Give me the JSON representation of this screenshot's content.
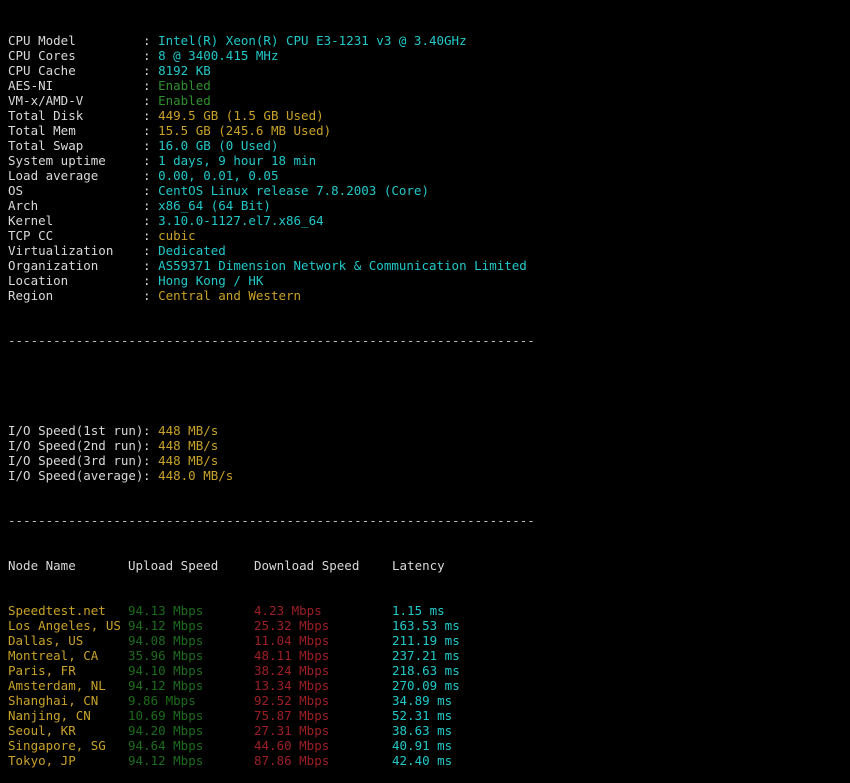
{
  "terminal": {
    "prompt_symbol": "",
    "separator": "----------------------------------------------------------------------"
  },
  "system_info": {
    "label_separator": ":",
    "rows": [
      {
        "label": "CPU Model",
        "value": "Intel(R) Xeon(R) CPU E3-1231 v3 @ 3.40GHz",
        "color": "cyan"
      },
      {
        "label": "CPU Cores",
        "value": "8 @ 3400.415 MHz",
        "color": "cyan"
      },
      {
        "label": "CPU Cache",
        "value": "8192 KB",
        "color": "cyan"
      },
      {
        "label": "AES-NI",
        "value": "Enabled",
        "color": "green"
      },
      {
        "label": "VM-x/AMD-V",
        "value": "Enabled",
        "color": "green"
      },
      {
        "label": "Total Disk",
        "value": "449.5 GB (1.5 GB Used)",
        "color": "yellow"
      },
      {
        "label": "Total Mem",
        "value": "15.5 GB (245.6 MB Used)",
        "color": "yellow"
      },
      {
        "label": "Total Swap",
        "value": "16.0 GB (0 Used)",
        "color": "cyan"
      },
      {
        "label": "System uptime",
        "value": "1 days, 9 hour 18 min",
        "color": "cyan"
      },
      {
        "label": "Load average",
        "value": "0.00, 0.01, 0.05",
        "color": "cyan"
      },
      {
        "label": "OS",
        "value": "CentOS Linux release 7.8.2003 (Core)",
        "color": "cyan"
      },
      {
        "label": "Arch",
        "value": "x86_64 (64 Bit)",
        "color": "cyan"
      },
      {
        "label": "Kernel",
        "value": "3.10.0-1127.el7.x86_64",
        "color": "cyan"
      },
      {
        "label": "TCP CC",
        "value": "cubic",
        "color": "yellow"
      },
      {
        "label": "Virtualization",
        "value": "Dedicated",
        "color": "cyan"
      },
      {
        "label": "Organization",
        "value": "AS59371 Dimension Network & Communication Limited",
        "color": "cyan"
      },
      {
        "label": "Location",
        "value": "Hong Kong / HK",
        "color": "cyan"
      },
      {
        "label": "Region",
        "value": "Central and Western",
        "color": "yellow"
      }
    ]
  },
  "io_speed": {
    "rows": [
      {
        "label": "I/O Speed(1st run)",
        "value": "448 MB/s"
      },
      {
        "label": "I/O Speed(2nd run)",
        "value": "448 MB/s"
      },
      {
        "label": "I/O Speed(3rd run)",
        "value": "448 MB/s"
      },
      {
        "label": "I/O Speed(average)",
        "value": "448.0 MB/s"
      }
    ]
  },
  "speedtest": {
    "headers": {
      "node": "Node Name",
      "upload": "Upload Speed",
      "download": "Download Speed",
      "latency": "Latency"
    },
    "rows": [
      {
        "node": "Speedtest.net",
        "upload": "94.13 Mbps",
        "download": "4.23 Mbps",
        "latency": "1.15 ms"
      },
      {
        "node": "Los Angeles, US",
        "upload": "94.12 Mbps",
        "download": "25.32 Mbps",
        "latency": "163.53 ms"
      },
      {
        "node": "Dallas, US",
        "upload": "94.08 Mbps",
        "download": "11.04 Mbps",
        "latency": "211.19 ms"
      },
      {
        "node": "Montreal, CA",
        "upload": "35.96 Mbps",
        "download": "48.11 Mbps",
        "latency": "237.21 ms"
      },
      {
        "node": "Paris, FR",
        "upload": "94.10 Mbps",
        "download": "38.24 Mbps",
        "latency": "218.63 ms"
      },
      {
        "node": "Amsterdam, NL",
        "upload": "94.12 Mbps",
        "download": "13.34 Mbps",
        "latency": "270.09 ms"
      },
      {
        "node": "Shanghai, CN",
        "upload": "9.86 Mbps",
        "download": "92.52 Mbps",
        "latency": "34.89 ms"
      },
      {
        "node": "Nanjing, CN",
        "upload": "10.69 Mbps",
        "download": "75.87 Mbps",
        "latency": "52.31 ms"
      },
      {
        "node": "Seoul, KR",
        "upload": "94.20 Mbps",
        "download": "27.31 Mbps",
        "latency": "38.63 ms"
      },
      {
        "node": "Singapore, SG",
        "upload": "94.64 Mbps",
        "download": "44.60 Mbps",
        "latency": "40.91 ms"
      },
      {
        "node": "Tokyo, JP",
        "upload": "94.12 Mbps",
        "download": "87.86 Mbps",
        "latency": "42.40 ms"
      }
    ]
  },
  "colors": {
    "background": "#000000",
    "label": "#d9d9d9",
    "cyan": "#23c8c8",
    "green": "#2f8f2f",
    "yellow": "#c8a22a",
    "upload": "#1d6b1d",
    "download": "#9c1f24",
    "latency": "#23c8c8",
    "separator": "#bdbdbd"
  }
}
